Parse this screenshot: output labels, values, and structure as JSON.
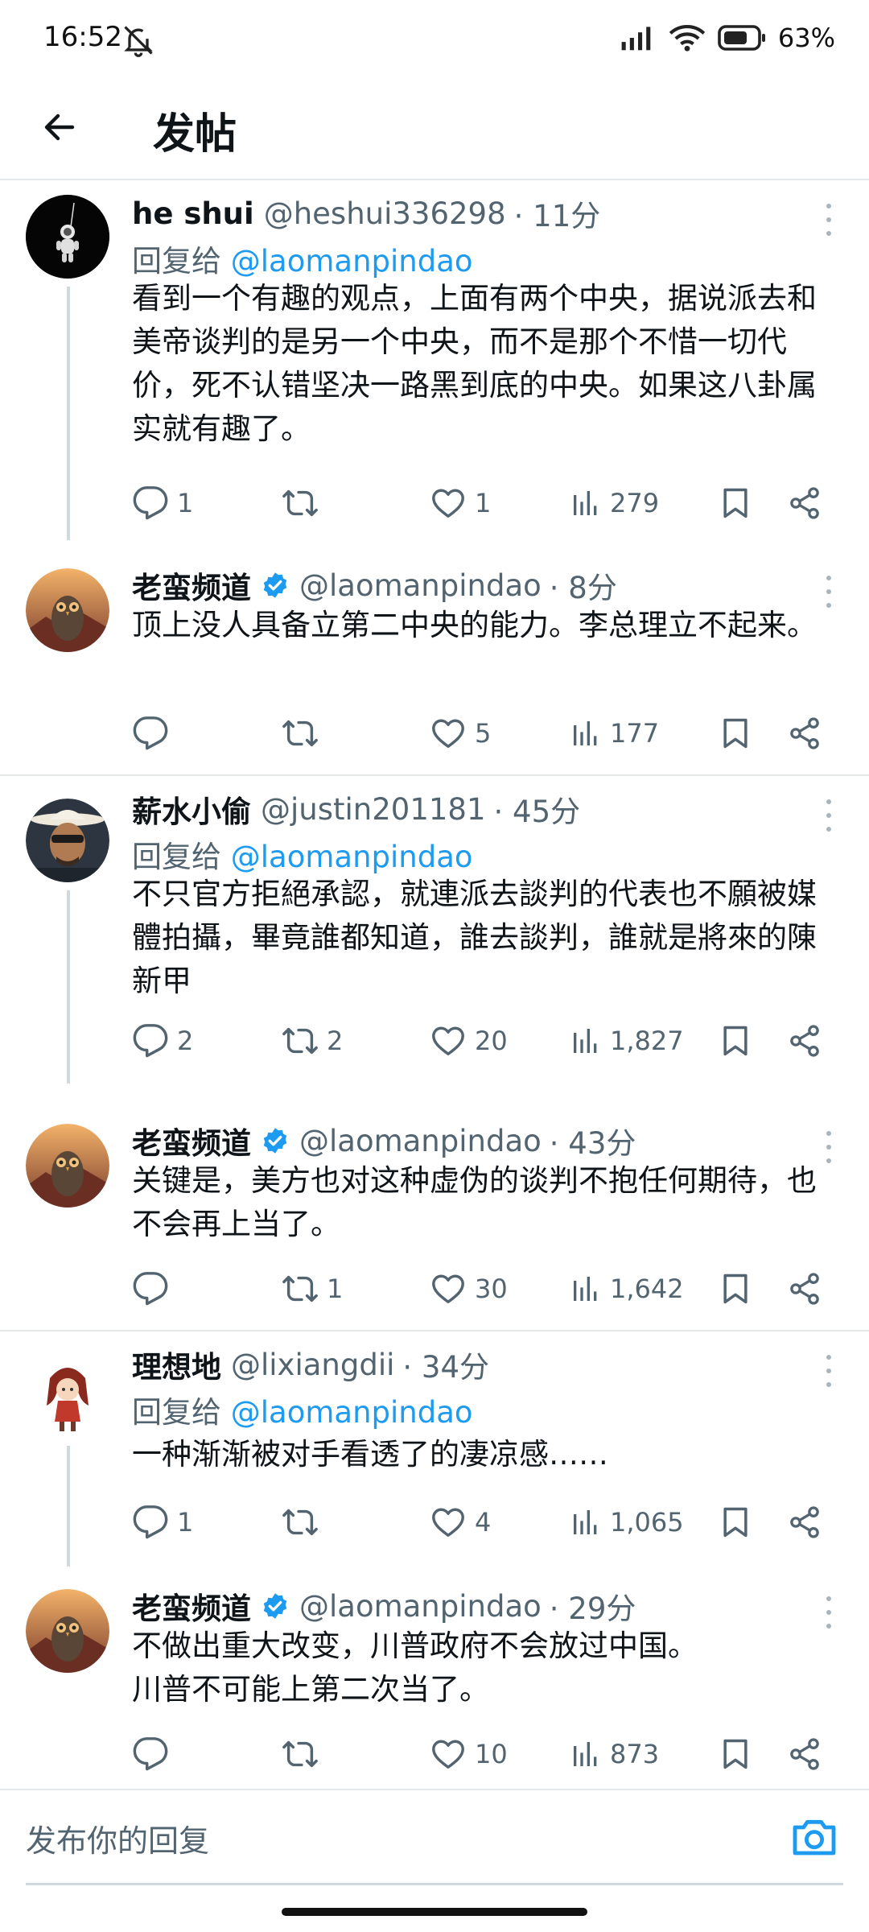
{
  "status_bar": {
    "time": "16:52",
    "battery": "63%"
  },
  "header": {
    "title": "发帖"
  },
  "threads": [
    {
      "parent": {
        "name": "he shui",
        "handle": "@heshui336298",
        "time": "· 11分",
        "reply_prefix": "回复给",
        "reply_to": "@laomanpindao",
        "text": "看到一个有趣的观点，上面有两个中央，据说派去和美帝谈判的是另一个中央，而不是那个不惜一切代价，死不认错坚决一路黑到底的中央。如果这八卦属实就有趣了。",
        "replies": "1",
        "retweets": "",
        "likes": "1",
        "views": "279"
      },
      "reply": {
        "name": "老蛮频道",
        "handle": "@laomanpindao",
        "time": "· 8分",
        "text": "顶上没人具备立第二中央的能力。李总理立不起来。",
        "replies": "",
        "retweets": "",
        "likes": "5",
        "views": "177"
      }
    },
    {
      "parent": {
        "name": "薪水小偷",
        "handle": "@justin201181",
        "time": "· 45分",
        "reply_prefix": "回复给",
        "reply_to": "@laomanpindao",
        "text": "不只官方拒絕承認，就連派去談判的代表也不願被媒體拍攝，畢竟誰都知道，誰去談判，誰就是將來的陳新甲",
        "replies": "2",
        "retweets": "2",
        "likes": "20",
        "views": "1,827"
      },
      "reply": {
        "name": "老蛮频道",
        "handle": "@laomanpindao",
        "time": "· 43分",
        "text": "关键是，美方也对这种虚伪的谈判不抱任何期待，也不会再上当了。",
        "replies": "",
        "retweets": "1",
        "likes": "30",
        "views": "1,642"
      }
    },
    {
      "parent": {
        "name": "理想地",
        "handle": "@lixiangdii",
        "time": "· 34分",
        "reply_prefix": "回复给",
        "reply_to": "@laomanpindao",
        "text": "一种渐渐被对手看透了的凄凉感……",
        "replies": "1",
        "retweets": "",
        "likes": "4",
        "views": "1,065"
      },
      "reply": {
        "name": "老蛮频道",
        "handle": "@laomanpindao",
        "time": "· 29分",
        "text_line1": "不做出重大改变，川普政府不会放过中国。",
        "text_line2": "川普不可能上第二次当了。",
        "replies": "",
        "retweets": "",
        "likes": "10",
        "views": "873"
      }
    }
  ],
  "reply_box": {
    "placeholder": "发布你的回复"
  },
  "icons": {
    "reply": "speech-bubble-icon",
    "retweet": "retweet-icon",
    "like": "heart-icon",
    "views": "bar-chart-icon",
    "bookmark": "bookmark-icon",
    "share": "share-icon",
    "verified": "verified-badge-icon",
    "more": "kebab-icon",
    "camera": "camera-icon"
  },
  "colors": {
    "link": "#1d9bf0",
    "muted": "#536471",
    "text": "#0f1419",
    "thread_line": "#cfd9de"
  }
}
